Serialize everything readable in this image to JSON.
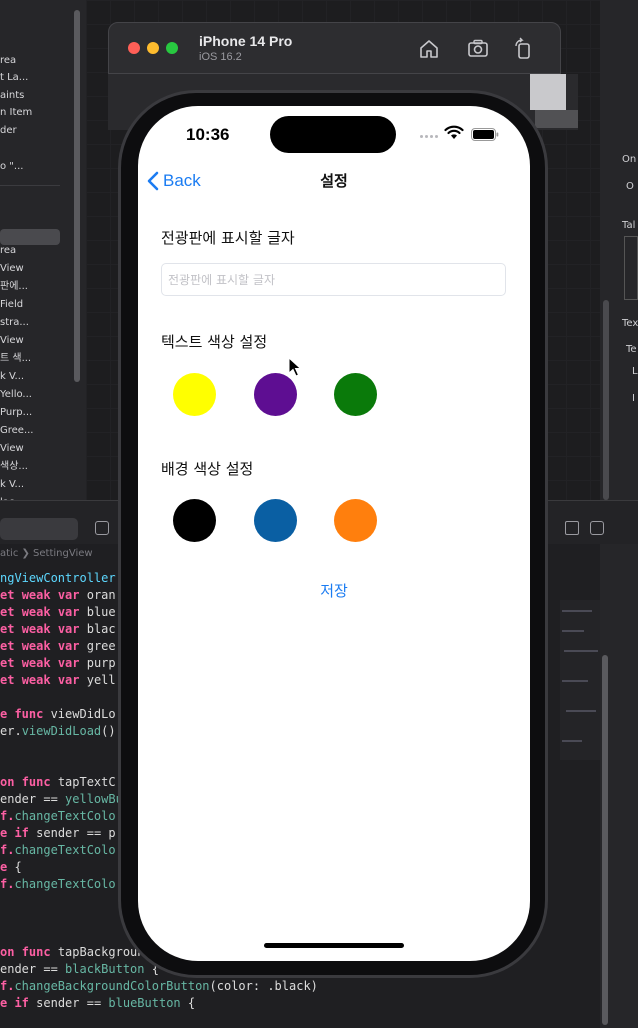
{
  "xcode": {
    "navigator_items": [
      "rea",
      "t La...",
      "aints",
      "n Item",
      "der",
      "",
      "o \"...",
      "",
      "",
      "",
      "rea",
      "View",
      "판에...",
      " Field",
      "stra...",
      "View",
      "트 색...",
      "k V...",
      "Yello...",
      "Purp...",
      "Gree...",
      "View",
      "색상...",
      "k V...",
      "lac..."
    ],
    "right_items": [
      "On",
      "O",
      "Tal",
      "Tex",
      "Te",
      "L",
      "I"
    ],
    "breadcrumb": "atic  ❯  SettingView",
    "code_lines": [
      [
        {
          "t": "ngViewController",
          "c": "ty"
        }
      ],
      [
        {
          "t": "et ",
          "c": "kw"
        },
        {
          "t": "weak ",
          "c": "kw"
        },
        {
          "t": "var ",
          "c": "kw"
        },
        {
          "t": "oran",
          "c": "pl"
        }
      ],
      [
        {
          "t": "et ",
          "c": "kw"
        },
        {
          "t": "weak ",
          "c": "kw"
        },
        {
          "t": "var ",
          "c": "kw"
        },
        {
          "t": "blue",
          "c": "pl"
        }
      ],
      [
        {
          "t": "et ",
          "c": "kw"
        },
        {
          "t": "weak ",
          "c": "kw"
        },
        {
          "t": "var ",
          "c": "kw"
        },
        {
          "t": "blac",
          "c": "pl"
        }
      ],
      [
        {
          "t": "et ",
          "c": "kw"
        },
        {
          "t": "weak ",
          "c": "kw"
        },
        {
          "t": "var ",
          "c": "kw"
        },
        {
          "t": "gree",
          "c": "pl"
        }
      ],
      [
        {
          "t": "et ",
          "c": "kw"
        },
        {
          "t": "weak ",
          "c": "kw"
        },
        {
          "t": "var ",
          "c": "kw"
        },
        {
          "t": "purp",
          "c": "pl"
        }
      ],
      [
        {
          "t": "et ",
          "c": "kw"
        },
        {
          "t": "weak ",
          "c": "kw"
        },
        {
          "t": "var ",
          "c": "kw"
        },
        {
          "t": "yell",
          "c": "pl"
        }
      ],
      [
        {
          "t": "",
          "c": "pl"
        }
      ],
      [
        {
          "t": "e ",
          "c": "kw"
        },
        {
          "t": "func ",
          "c": "kw"
        },
        {
          "t": "viewDidLo",
          "c": "pl"
        }
      ],
      [
        {
          "t": "er.",
          "c": "pl"
        },
        {
          "t": "viewDidLoad",
          "c": "fn"
        },
        {
          "t": "()",
          "c": "pl"
        }
      ],
      [
        {
          "t": "",
          "c": "pl"
        }
      ],
      [
        {
          "t": "",
          "c": "pl"
        }
      ],
      [
        {
          "t": "on ",
          "c": "kw"
        },
        {
          "t": "func ",
          "c": "kw"
        },
        {
          "t": "tapTextC",
          "c": "pl"
        }
      ],
      [
        {
          "t": "ender == ",
          "c": "pl"
        },
        {
          "t": "yellowBu",
          "c": "fn"
        }
      ],
      [
        {
          "t": "f.",
          "c": "kw"
        },
        {
          "t": "changeTextColo",
          "c": "fn"
        }
      ],
      [
        {
          "t": "e ",
          "c": "kw"
        },
        {
          "t": "if ",
          "c": "kw"
        },
        {
          "t": "sender == p",
          "c": "pl"
        }
      ],
      [
        {
          "t": "f.",
          "c": "kw"
        },
        {
          "t": "changeTextColo",
          "c": "fn"
        }
      ],
      [
        {
          "t": "e ",
          "c": "kw"
        },
        {
          "t": "{",
          "c": "pl"
        }
      ],
      [
        {
          "t": "f.",
          "c": "kw"
        },
        {
          "t": "changeTextColo",
          "c": "fn"
        }
      ],
      [
        {
          "t": "",
          "c": "pl"
        }
      ],
      [
        {
          "t": "",
          "c": "pl"
        }
      ],
      [
        {
          "t": "",
          "c": "pl"
        }
      ],
      [
        {
          "t": "on ",
          "c": "kw"
        },
        {
          "t": "func ",
          "c": "kw"
        },
        {
          "t": "tapBackgroundCo",
          "c": "pl"
        }
      ],
      [
        {
          "t": "ender == ",
          "c": "pl"
        },
        {
          "t": "blackButton ",
          "c": "fn"
        },
        {
          "t": "{",
          "c": "pl"
        }
      ],
      [
        {
          "t": "f.",
          "c": "kw"
        },
        {
          "t": "changeBackgroundColorButton",
          "c": "fn"
        },
        {
          "t": "(color: .black)",
          "c": "pl"
        }
      ],
      [
        {
          "t": "e ",
          "c": "kw"
        },
        {
          "t": "if ",
          "c": "kw"
        },
        {
          "t": "sender == ",
          "c": "pl"
        },
        {
          "t": "blueButton ",
          "c": "fn"
        },
        {
          "t": "{",
          "c": "pl"
        }
      ]
    ]
  },
  "simulator": {
    "device_name": "iPhone 14 Pro",
    "os_version": "iOS 16.2",
    "toolbar_icons": [
      "home-icon",
      "screenshot-icon",
      "rotate-icon"
    ]
  },
  "phone": {
    "status_time": "10:36",
    "nav": {
      "back_label": "Back",
      "title": "설정"
    },
    "display_text": {
      "label": "전광판에 표시할 글자",
      "placeholder": "전광판에 표시할 글자",
      "value": ""
    },
    "text_color": {
      "label": "텍스트 색상 설정",
      "options": [
        {
          "name": "yellow",
          "color": "#ffff00"
        },
        {
          "name": "purple",
          "color": "#5e0e92"
        },
        {
          "name": "green",
          "color": "#0a7a0a"
        }
      ]
    },
    "background_color": {
      "label": "배경 색상 설정",
      "options": [
        {
          "name": "black",
          "color": "#000000"
        },
        {
          "name": "blue",
          "color": "#0a5fa3"
        },
        {
          "name": "orange",
          "color": "#ff7f0d"
        }
      ]
    },
    "save_label": "저장",
    "accent_color": "#1b7cf2"
  }
}
